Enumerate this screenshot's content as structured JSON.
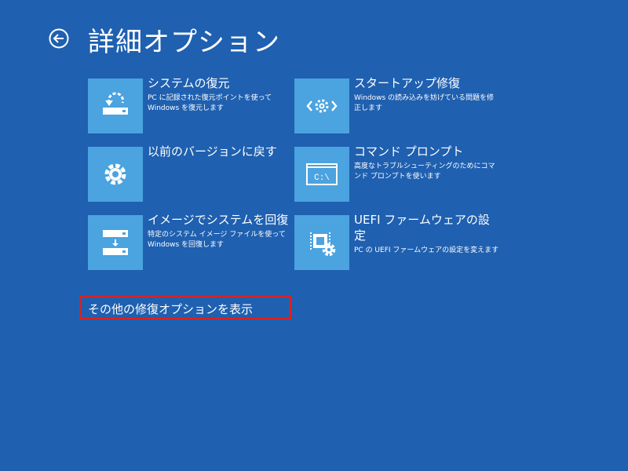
{
  "header": {
    "title": "詳細オプション",
    "back_icon": "back-arrow-icon"
  },
  "options": [
    {
      "title": "システムの復元",
      "description": "PC に記録された復元ポイントを使って Windows を復元します",
      "icon": "system-restore-icon"
    },
    {
      "title": "スタートアップ修復",
      "description": "Windows の読み込みを妨げている問題を修正します",
      "icon": "startup-repair-icon"
    },
    {
      "title": "以前のバージョンに戻す",
      "description": "",
      "icon": "gear-icon"
    },
    {
      "title": "コマンド プロンプト",
      "description": "高度なトラブルシューティングのためにコマンド プロンプトを使います",
      "icon": "command-prompt-icon",
      "icon_text": "C:\\"
    },
    {
      "title": "イメージでシステムを回復",
      "description": "特定のシステム イメージ ファイルを使って Windows を回復します",
      "icon": "system-image-recovery-icon"
    },
    {
      "title": "UEFI ファームウェアの設定",
      "description": "PC の UEFI ファームウェアの設定を変えます",
      "icon": "uefi-firmware-icon"
    }
  ],
  "more_options": {
    "label": "その他の修復オプションを表示",
    "highlight_color": "#e0201c"
  },
  "colors": {
    "background": "#1f60b0",
    "tile": "#4ba3df",
    "text": "#ffffff"
  }
}
